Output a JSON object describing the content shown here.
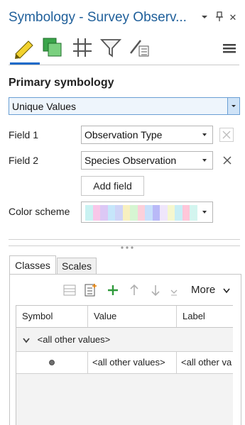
{
  "pane": {
    "title": "Symbology - Survey Observ...",
    "close_glyph": "✕"
  },
  "heading": "Primary symbology",
  "renderer": {
    "value": "Unique Values"
  },
  "field1": {
    "label": "Field 1",
    "value": "Observation Type"
  },
  "field2": {
    "label": "Field 2",
    "value": "Species Observation"
  },
  "add_field": "Add field",
  "color_scheme": {
    "label": "Color scheme",
    "colors": [
      "#c9f2f2",
      "#f8c6e8",
      "#dcc8f5",
      "#c6e6fa",
      "#cfd4f7",
      "#f7f0c0",
      "#d6f5d2",
      "#fbd0da",
      "#c8e0fb",
      "#b9b9f7",
      "#efe6fb",
      "#f5f7cf",
      "#c8eef5",
      "#ffc6d9",
      "#d3f5ef"
    ]
  },
  "tabs": [
    "Classes",
    "Scales"
  ],
  "more_label": "More",
  "table": {
    "headers": [
      "Symbol",
      "Value",
      "Label"
    ],
    "group": "<all other values>",
    "row": {
      "value": "<all other values>",
      "label": "<all other va"
    }
  }
}
